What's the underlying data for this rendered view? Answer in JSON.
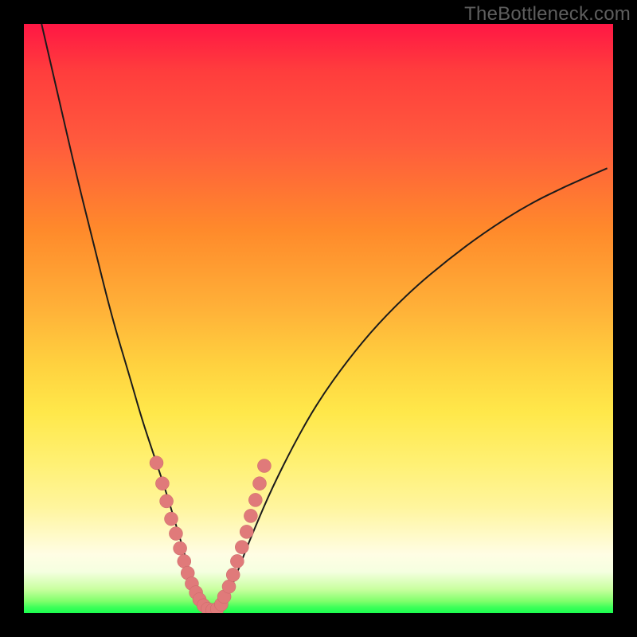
{
  "watermark": "TheBottleneck.com",
  "chart_data": {
    "type": "line",
    "title": "",
    "xlabel": "",
    "ylabel": "",
    "xlim": [
      0,
      100
    ],
    "ylim": [
      0,
      100
    ],
    "gradient_stops": [
      {
        "pos": 0,
        "color": "#ff1744"
      },
      {
        "pos": 8,
        "color": "#ff3d3d"
      },
      {
        "pos": 20,
        "color": "#ff5a3d"
      },
      {
        "pos": 35,
        "color": "#ff8a2b"
      },
      {
        "pos": 48,
        "color": "#ffb038"
      },
      {
        "pos": 58,
        "color": "#ffd23f"
      },
      {
        "pos": 66,
        "color": "#ffe84a"
      },
      {
        "pos": 75,
        "color": "#fff176"
      },
      {
        "pos": 82,
        "color": "#fff59d"
      },
      {
        "pos": 90,
        "color": "#fffde4"
      },
      {
        "pos": 93,
        "color": "#f5ffe0"
      },
      {
        "pos": 96,
        "color": "#c8ff9e"
      },
      {
        "pos": 98,
        "color": "#7fff6b"
      },
      {
        "pos": 99,
        "color": "#3fff5a"
      },
      {
        "pos": 100,
        "color": "#19ff4d"
      }
    ],
    "series": [
      {
        "name": "left-branch",
        "x": [
          3,
          6,
          9,
          12,
          15,
          18,
          20,
          22,
          24,
          25.5,
          27,
          28,
          29,
          29.8,
          30.5,
          31
        ],
        "y": [
          100,
          87,
          74,
          62,
          50,
          40,
          33,
          27,
          21,
          16,
          11,
          7.5,
          4.5,
          2.5,
          1.2,
          0.5
        ]
      },
      {
        "name": "right-branch",
        "x": [
          33,
          34,
          35.5,
          37,
          39,
          42,
          46,
          50,
          55,
          60,
          66,
          72,
          78,
          85,
          92,
          99
        ],
        "y": [
          0.5,
          2,
          5,
          9,
          14,
          21,
          29,
          36,
          43,
          49,
          55,
          60,
          64.5,
          69,
          72.5,
          75.5
        ]
      }
    ],
    "markers": {
      "name": "highlight-points",
      "color": "#e07a7a",
      "x": [
        22.5,
        23.5,
        24.2,
        25.0,
        25.8,
        26.5,
        27.2,
        27.8,
        28.5,
        29.2,
        29.8,
        30.5,
        31.2,
        32.0,
        32.8,
        33.5,
        34.0,
        34.8,
        35.5,
        36.2,
        37.0,
        37.8,
        38.5,
        39.3,
        40.0,
        40.8
      ],
      "y": [
        25.5,
        22.0,
        19.0,
        16.0,
        13.5,
        11.0,
        8.8,
        6.8,
        5.0,
        3.5,
        2.3,
        1.3,
        0.7,
        0.5,
        0.7,
        1.5,
        2.8,
        4.5,
        6.5,
        8.8,
        11.2,
        13.8,
        16.5,
        19.2,
        22.0,
        25.0
      ]
    }
  }
}
